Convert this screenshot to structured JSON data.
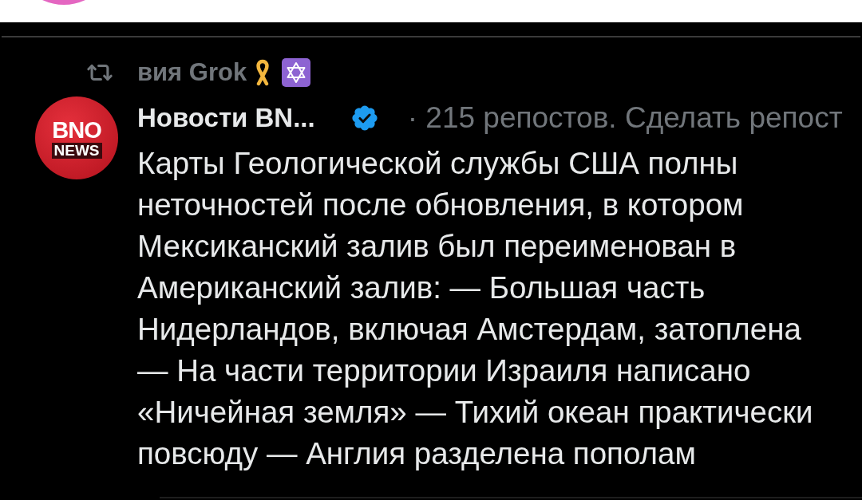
{
  "repost_banner": {
    "label": "вия Grok"
  },
  "post": {
    "avatar": {
      "title": "BNO",
      "subtitle": "NEWS"
    },
    "author": "Новости BN...",
    "verified": true,
    "meta": "· 215 репостов. Сделать репост",
    "text": "Карты Геологической службы США полны неточностей после обновления, в котором Мексиканский залив был переименован в Американский залив: — Большая часть Нидерландов, включая Амстердам, затоплена — На части территории Израиля написано «Ничейная земля» — Тихий океан практически повсюду — Англия разделена пополам"
  }
}
